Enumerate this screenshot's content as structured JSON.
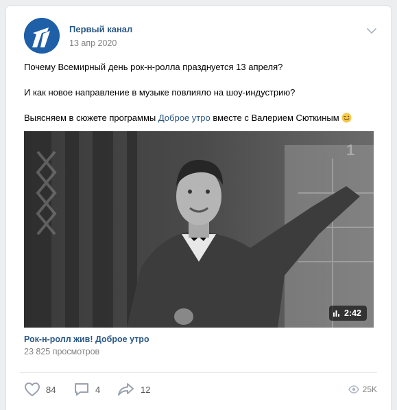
{
  "post": {
    "author": "Первый канал",
    "date": "13 апр 2020",
    "text": {
      "line1": "Почему Всемирный день рок-н-ролла празднуется 13 апреля?",
      "line2": "И как новое направление в музыке повлияло на шоу-индустрию?",
      "line3_before": "Выясняем в сюжете программы ",
      "line3_link": "Доброе утро",
      "line3_after": " вместе с Валерием Сюткиным"
    },
    "video": {
      "duration": "2:42",
      "title": "Рок-н-ролл жив! Доброе утро",
      "views": "23 825 просмотров"
    },
    "actions": {
      "likes": "84",
      "comments": "4",
      "shares": "12",
      "views": "25K"
    }
  },
  "colors": {
    "link": "#2a5885",
    "muted": "#828282",
    "avatar": "#1f5fa8"
  },
  "icons": [
    "channel-one-logo",
    "chevron-down-icon",
    "wink-emoji-icon",
    "playlist-icon",
    "heart-icon",
    "comment-icon",
    "share-icon",
    "eye-icon"
  ]
}
